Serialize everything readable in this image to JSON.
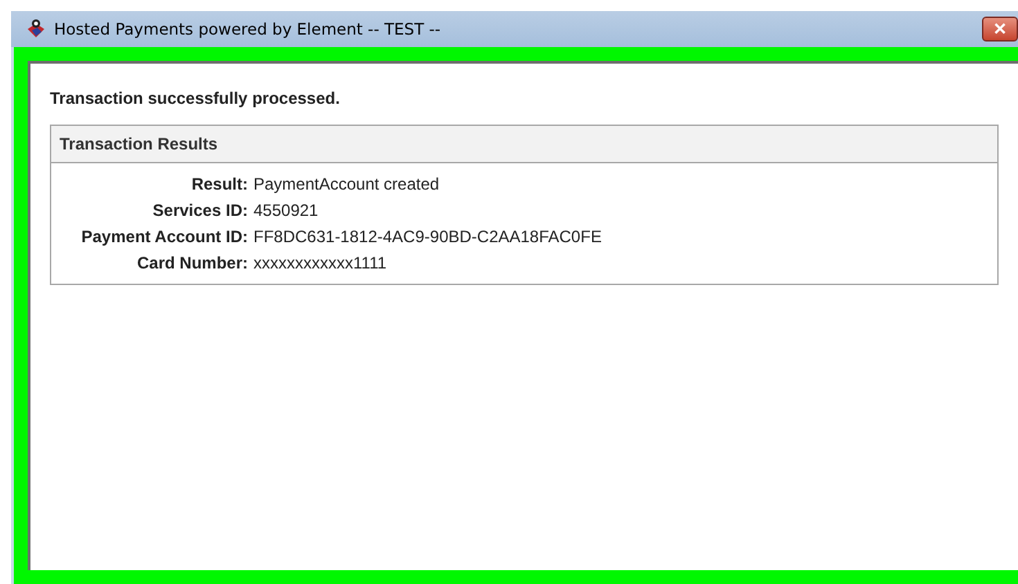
{
  "window": {
    "title": "Hosted Payments powered by Element -- TEST --",
    "close": "✕"
  },
  "message": "Transaction successfully processed.",
  "results": {
    "title": "Transaction Results",
    "rows": [
      {
        "label": "Result:",
        "value": "PaymentAccount created"
      },
      {
        "label": "Services ID:",
        "value": "4550921"
      },
      {
        "label": "Payment Account ID:",
        "value": "FF8DC631-1812-4AC9-90BD-C2AA18FAC0FE"
      },
      {
        "label": "Card Number:",
        "value": "xxxxxxxxxxxx1111"
      }
    ]
  }
}
